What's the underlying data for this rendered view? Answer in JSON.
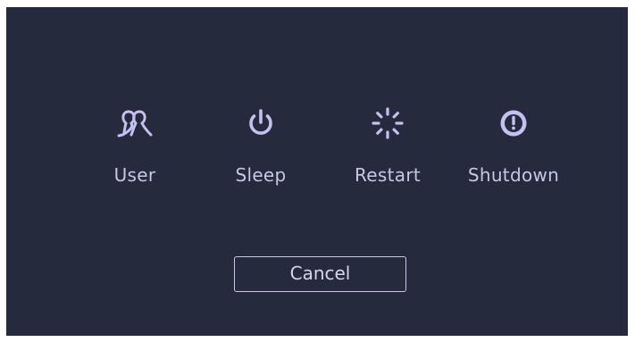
{
  "dialog": {
    "actions": [
      {
        "label": "User",
        "icon": "users-icon"
      },
      {
        "label": "Sleep",
        "icon": "power-icon"
      },
      {
        "label": "Restart",
        "icon": "restart-spinner-icon"
      },
      {
        "label": "Shutdown",
        "icon": "shutdown-icon"
      }
    ],
    "cancel_label": "Cancel"
  },
  "colors": {
    "background": "#262a3d",
    "icon": "#c4c0ef",
    "text": "#c9c6e6"
  }
}
